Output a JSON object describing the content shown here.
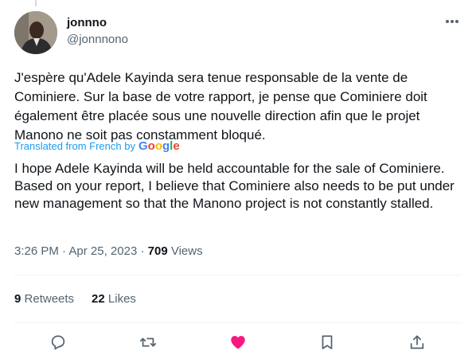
{
  "tweet": {
    "display_name": "jonnno",
    "handle": "@jonnnono",
    "text_original": "J'espère qu'Adele Kayinda sera tenue responsable de la vente de Cominiere. Sur la base de votre rapport, je pense que Cominiere doit également être placée sous une nouvelle direction afin que le projet Manono ne soit pas constamment bloqué.",
    "translated_label": "Translated from French by",
    "translator": "Google",
    "text_translated": "I hope Adele Kayinda will be held accountable for the sale of Cominiere. Based on your report, I believe that Cominiere also needs to be put under new management so that the Manono project is not constantly stalled.",
    "time": "3:26 PM",
    "date": "Apr 25, 2023",
    "views_count": "709",
    "views_label": "Views"
  },
  "stats": {
    "retweets_count": "9",
    "retweets_label": "Retweets",
    "likes_count": "22",
    "likes_label": "Likes"
  },
  "icons": {
    "more": "more-dots-icon",
    "reply": "reply-icon",
    "retweet": "retweet-icon",
    "like": "heart-icon",
    "bookmark": "bookmark-icon",
    "share": "share-icon"
  },
  "colors": {
    "link": "#1d9bf0",
    "like_active": "#f91880",
    "muted": "#536471",
    "text": "#0f1419"
  }
}
